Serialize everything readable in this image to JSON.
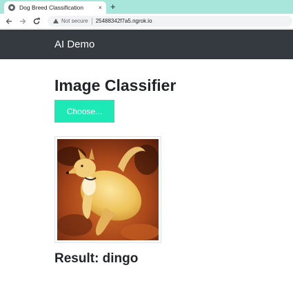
{
  "browser": {
    "tab_title": "Dog Breed Classification",
    "tab_close": "×",
    "new_tab": "+",
    "not_secure": "Not secure",
    "url": "25488342f7a5.ngrok.io",
    "icons": {
      "favicon": "globe-icon",
      "back": "back-arrow-icon",
      "forward": "forward-arrow-icon",
      "reload": "reload-icon",
      "security": "warning-icon"
    }
  },
  "navbar": {
    "brand": "AI Demo",
    "background": "#343a40"
  },
  "main": {
    "title": "Image Classifier",
    "choose_button": "Choose...",
    "choose_button_color": "#1de9b6",
    "preview_alt": "dingo",
    "result_label": "Result: dingo"
  }
}
